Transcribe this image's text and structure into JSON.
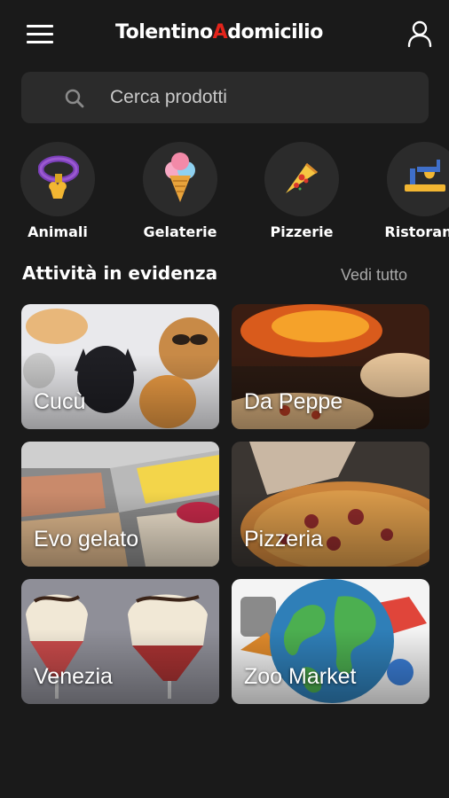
{
  "header": {
    "logo_part1": "Tolentino",
    "logo_part2": "A",
    "logo_part3": "domicilio",
    "menu_icon": "hamburger-menu-icon",
    "user_icon": "user-icon"
  },
  "search": {
    "placeholder": "Cerca prodotti",
    "icon": "search-icon"
  },
  "categories": [
    {
      "label": "Animali",
      "icon": "pet-collar-icon"
    },
    {
      "label": "Gelaterie",
      "icon": "ice-cream-icon"
    },
    {
      "label": "Pizzerie",
      "icon": "pizza-slice-icon"
    },
    {
      "label": "Ristoranti",
      "icon": "restaurant-icon"
    }
  ],
  "featured": {
    "title": "Attività in evidenza",
    "see_all": "Vedi tutto",
    "items": [
      {
        "name": "Cucù"
      },
      {
        "name": "Da Peppe"
      },
      {
        "name": "Evo gelato"
      },
      {
        "name": "Pizzeria"
      },
      {
        "name": "Venezia"
      },
      {
        "name": "Zoo Market"
      }
    ]
  },
  "colors": {
    "background": "#1a1a1a",
    "surface": "#2b2b2b",
    "logo_accent": "#e3241b",
    "muted_text": "#a9a9a9"
  }
}
